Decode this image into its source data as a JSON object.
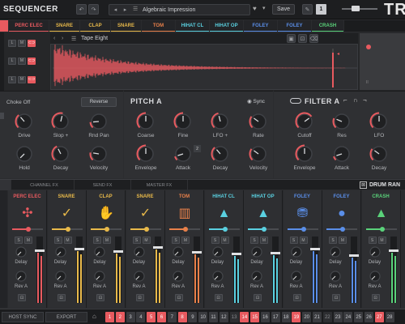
{
  "app": {
    "title": "SEQUENCER",
    "brand": "TR",
    "preset": "Algebraic Impression",
    "save_label": "Save",
    "badge": "1"
  },
  "tabs": [
    {
      "label": "PERC ELEC",
      "color": "#e85a5f"
    },
    {
      "label": "SNARE",
      "color": "#e8b94a"
    },
    {
      "label": "CLAP",
      "color": "#e8b94a"
    },
    {
      "label": "SNARE",
      "color": "#e8b94a"
    },
    {
      "label": "TOM",
      "color": "#e8804a"
    },
    {
      "label": "HIHAT CL",
      "color": "#5ad0e0"
    },
    {
      "label": "HIHAT OP",
      "color": "#5ad0e0"
    },
    {
      "label": "FOLEY",
      "color": "#5a8ee8"
    },
    {
      "label": "FOLEY",
      "color": "#5a8ee8"
    },
    {
      "label": "CRASH",
      "color": "#5ad27a"
    }
  ],
  "sample": {
    "name": "Tape Eight",
    "row_labels": [
      "L",
      "M",
      "L",
      "M",
      "L",
      "M"
    ]
  },
  "amp": {
    "choke": "Choke Off",
    "reverse": "Reverse",
    "knobs": [
      "Drive",
      "Slop +",
      "Rnd Pan",
      "Hold",
      "Decay",
      "Velocity"
    ]
  },
  "pitch": {
    "title": "PITCH A",
    "sync": "Sync",
    "knobs": [
      "Coarse",
      "Fine",
      "LFO +",
      "Rate",
      "Envelope",
      "Attack",
      "Decay",
      "Velocity"
    ],
    "badge": "2"
  },
  "filter": {
    "title": "FILTER A",
    "knobs": [
      "Cutoff",
      "Res",
      "LFO",
      "Envelope",
      "Attack",
      "Decay"
    ]
  },
  "fxtabs": [
    "CHANNEL FX",
    "SEND FX",
    "MASTER FX"
  ],
  "drum_rack": "DRUM RAN",
  "strips": [
    {
      "name": "PERC ELEC",
      "color": "#e85a5f",
      "icon": "✣",
      "delay": "Delay",
      "rev": "Rev A"
    },
    {
      "name": "SNARE",
      "color": "#e8b94a",
      "icon": "✓",
      "delay": "Delay",
      "rev": "Rev A"
    },
    {
      "name": "CLAP",
      "color": "#e8b94a",
      "icon": "✋",
      "delay": "Delay",
      "rev": "Rev A"
    },
    {
      "name": "SNARE",
      "color": "#e8b94a",
      "icon": "✓",
      "delay": "Delay",
      "rev": "Rev A"
    },
    {
      "name": "TOM",
      "color": "#e8804a",
      "icon": "▥",
      "delay": "Delay",
      "rev": "Rev A"
    },
    {
      "name": "HIHAT CL",
      "color": "#5ad0e0",
      "icon": "▲",
      "delay": "Delay",
      "rev": "Rev A"
    },
    {
      "name": "HIHAT OP",
      "color": "#5ad0e0",
      "icon": "▲",
      "delay": "Delay",
      "rev": "Rev A"
    },
    {
      "name": "FOLEY",
      "color": "#5a8ee8",
      "icon": "⛃",
      "delay": "Delay",
      "rev": "Rev A"
    },
    {
      "name": "FOLEY",
      "color": "#5a8ee8",
      "icon": "●",
      "delay": "Delay",
      "rev": "Rev A"
    },
    {
      "name": "CRASH",
      "color": "#5ad27a",
      "icon": "▲",
      "delay": "Delay",
      "rev": "Rev A"
    }
  ],
  "bottom": {
    "host_sync": "HOST SYNC",
    "export": "EXPORT"
  },
  "steps": [
    {
      "n": "1",
      "s": "on"
    },
    {
      "n": "2",
      "s": "on"
    },
    {
      "n": "3",
      "s": ""
    },
    {
      "n": "4",
      "s": ""
    },
    {
      "n": "5",
      "s": "on"
    },
    {
      "n": "6",
      "s": "on"
    },
    {
      "n": "7",
      "s": ""
    },
    {
      "n": "8",
      "s": "on"
    },
    {
      "n": "9",
      "s": ""
    },
    {
      "n": "10",
      "s": ""
    },
    {
      "n": "11",
      "s": ""
    },
    {
      "n": "12",
      "s": ""
    },
    {
      "n": "13",
      "s": "dim"
    },
    {
      "n": "14",
      "s": "on"
    },
    {
      "n": "15",
      "s": "on"
    },
    {
      "n": "16",
      "s": ""
    },
    {
      "n": "17",
      "s": ""
    },
    {
      "n": "18",
      "s": ""
    },
    {
      "n": "19",
      "s": "on"
    },
    {
      "n": "20",
      "s": ""
    },
    {
      "n": "21",
      "s": ""
    },
    {
      "n": "22",
      "s": "dim"
    },
    {
      "n": "23",
      "s": ""
    },
    {
      "n": "24",
      "s": ""
    },
    {
      "n": "25",
      "s": ""
    },
    {
      "n": "26",
      "s": ""
    },
    {
      "n": "27",
      "s": "on"
    },
    {
      "n": "28",
      "s": ""
    }
  ]
}
